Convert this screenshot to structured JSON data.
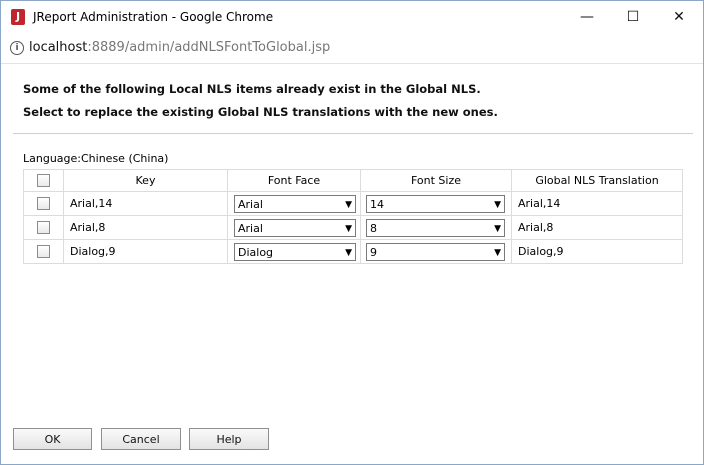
{
  "window": {
    "app_icon_letter": "J",
    "title": "JReport Administration - Google Chrome",
    "minimize": "—",
    "maximize": "☐",
    "close": "✕"
  },
  "address": {
    "info_icon": "i",
    "host": "localhost",
    "path": ":8889/admin/addNLSFontToGlobal.jsp"
  },
  "messages": {
    "line1": "Some of the following Local NLS items already exist in the Global NLS.",
    "line2": "Select to replace the existing Global NLS translations with the new ones."
  },
  "language": {
    "label": "Language:",
    "value": "Chinese (China)"
  },
  "table": {
    "headers": {
      "key": "Key",
      "font_face": "Font Face",
      "font_size": "Font Size",
      "global": "Global NLS Translation"
    },
    "rows": [
      {
        "key": "Arial,14",
        "font_face": "Arial",
        "font_size": "14",
        "global": "Arial,14"
      },
      {
        "key": "Arial,8",
        "font_face": "Arial",
        "font_size": "8",
        "global": "Arial,8"
      },
      {
        "key": "Dialog,9",
        "font_face": "Dialog",
        "font_size": "9",
        "global": "Dialog,9"
      }
    ]
  },
  "buttons": {
    "ok": "OK",
    "cancel": "Cancel",
    "help": "Help"
  },
  "icons": {
    "dropdown_arrow": "▼"
  }
}
